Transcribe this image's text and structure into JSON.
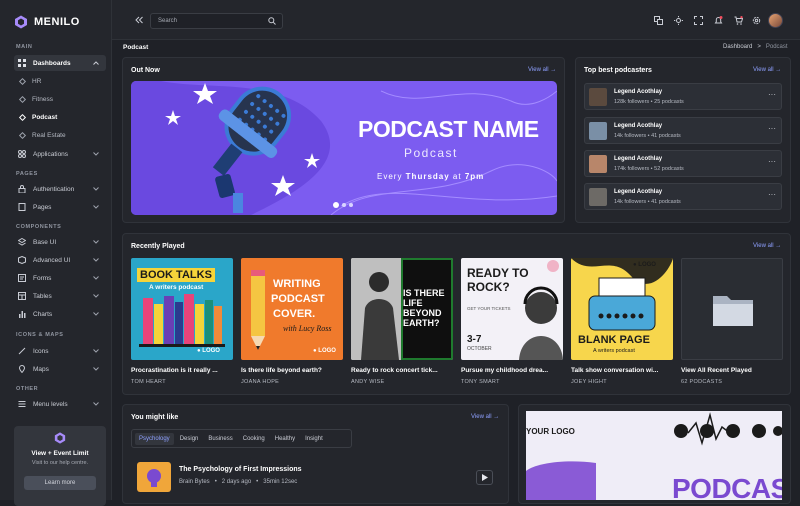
{
  "brand": {
    "name": "MENILO"
  },
  "sidebar": {
    "sections": {
      "main": "MAIN",
      "pages": "PAGES",
      "components": "COMPONENTS",
      "icons_maps": "ICONS & MAPS",
      "other": "OTHER"
    },
    "dashboards": "Dashboards",
    "sub": [
      "HR",
      "Fitness",
      "Podcast",
      "Real Estate"
    ],
    "applications": "Applications",
    "authentication": "Authentication",
    "pages": "Pages",
    "components": [
      "Base UI",
      "Advanced UI",
      "Forms",
      "Tables",
      "Charts"
    ],
    "icons": "Icons",
    "maps": "Maps",
    "menu_levels": "Menu levels",
    "promo": {
      "title": "View + Event Limit",
      "subtitle": "Visit to our help centre.",
      "button": "Learn more"
    }
  },
  "topbar": {
    "search_placeholder": "Search"
  },
  "breadcrumb": {
    "title": "Podcast",
    "items": [
      "Dashboard",
      "Podcast"
    ],
    "separator": ">"
  },
  "out_now": {
    "title": "Out Now",
    "view_all": "View all →",
    "banner": {
      "name": "PODCAST NAME",
      "sub": "Podcast",
      "time_prefix": "Every ",
      "time_day": "Thursday",
      "time_suffix": " at ",
      "time_hour": "7pm"
    }
  },
  "top_podcasters": {
    "title": "Top best podcasters",
    "view_all": "View all →",
    "items": [
      {
        "name": "Legend Acothlay",
        "meta": "128k followers • 25 podcasts",
        "bg": "#5b4a3e"
      },
      {
        "name": "Legend Acothlay",
        "meta": "14k followers • 41 podcasts",
        "bg": "#7a8fa6"
      },
      {
        "name": "Legend Acothlay",
        "meta": "174k followers • 52 podcasts",
        "bg": "#b8866a"
      },
      {
        "name": "Legend Acothlay",
        "meta": "14k followers • 41 podcasts",
        "bg": "#6d6a66"
      }
    ]
  },
  "recently_played": {
    "title": "Recently Played",
    "view_all": "View all →",
    "items": [
      {
        "title": "Procrastination is it really ...",
        "author": "TOM HEART"
      },
      {
        "title": "Is there life beyond earth?",
        "author": "JOANA HOPE"
      },
      {
        "title": "Ready to rock concert tick...",
        "author": "ANDY WISE"
      },
      {
        "title": "Pursue my childhood drea...",
        "author": "TONY SMART"
      },
      {
        "title": "Talk show conversation wi...",
        "author": "JOEY HIGHT"
      },
      {
        "title": "View All Recent Played",
        "author": "62 PODCASTS"
      }
    ],
    "covers": {
      "c1": {
        "line1": "BOOK TALKS",
        "line2": "A writers podcast",
        "logo": "● LOGO"
      },
      "c2": {
        "line1": "WRITING",
        "line2": "PODCAST",
        "line3": "COVER.",
        "line4": "with Lucy Ross",
        "logo": "● LOGO"
      },
      "c3": {
        "line1": "IS THERE",
        "line2": "LIFE",
        "line3": "BEYOND",
        "line4": "EARTH?"
      },
      "c4": {
        "line1": "READY TO",
        "line2": "ROCK?",
        "line3": "GET YOUR TICKETS",
        "line4": "3-7",
        "line5": "OCTOBER"
      },
      "c5": {
        "line1": "BLANK PAGE",
        "line2": "A writers podcast",
        "logo": "● LOGO"
      }
    }
  },
  "you_might_like": {
    "title": "You might like",
    "view_all": "View all →",
    "tabs": [
      "Psychology",
      "Design",
      "Business",
      "Cooking",
      "Healthy",
      "Insight"
    ],
    "episode": {
      "title": "The Psychology of First Impressions",
      "show": "Brain Bytes",
      "ago": "2 days ago",
      "duration": "35min 12sec"
    }
  },
  "promo_art": {
    "logo": "YOUR LOGO",
    "word": "PODCAS"
  },
  "colors": {
    "accent": "#8ea0ff",
    "banner": "#7c5cf0",
    "bg": "#1f2127",
    "panel": "#24262c"
  }
}
